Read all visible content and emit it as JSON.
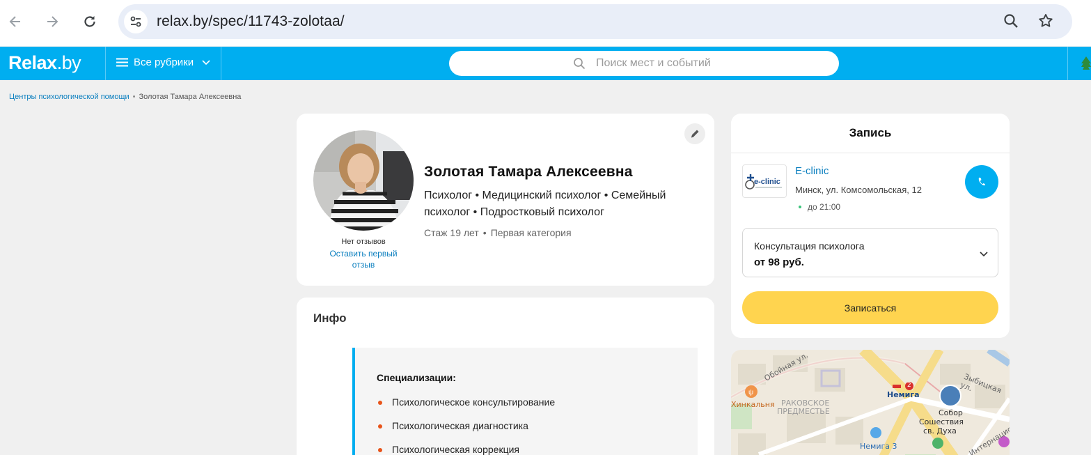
{
  "browser": {
    "url": "relax.by/spec/11743-zolotaa/"
  },
  "site": {
    "logo_main": "Relax",
    "logo_domain": ".by",
    "rubrics_label": "Все рубрики",
    "search_placeholder": "Поиск мест и событий",
    "brand_color": "#00aef0"
  },
  "breadcrumb": {
    "parent": "Центры психологической помощи",
    "separator": "•",
    "current": "Золотая Тамара Алексеевна"
  },
  "profile": {
    "name": "Золотая Тамара Алексеевна",
    "specializations": "Психолог • Медицинский психолог • Семейный психолог • Подростковый психолог",
    "experience": "Стаж 19 лет",
    "meta_separator": "•",
    "category": "Первая категория",
    "reviews_status": "Нет отзывов",
    "first_review_link": "Оставить первый отзыв"
  },
  "info": {
    "title": "Инфо",
    "spec_heading": "Специализации:",
    "spec_items": [
      "Психологическое консультирование",
      "Психологическая диагностика",
      "Психологическая коррекция"
    ]
  },
  "booking": {
    "title": "Запись",
    "clinic_name": "E-clinic",
    "clinic_logo_text": "e-clinic",
    "clinic_address": "Минск, ул. Комсомольская, 12",
    "clinic_hours": "до 21:00",
    "service_name": "Консультация психолога",
    "service_price": "от 98 руб.",
    "book_button": "Записаться",
    "button_color": "#ffd44f"
  },
  "map": {
    "labels": {
      "street1": "Обойная ул.",
      "district": "РАКОВСКОЕ ПРЕДМЕСТЬЕ",
      "district_line1": "РАКОВСКОЕ",
      "district_line2": "ПРЕДМЕСТЬЕ",
      "restaurant": "Хинкальня",
      "metro": "Немига",
      "metro_line": "2",
      "cathedral_line1": "Собор",
      "cathedral_line2": "Сошествия",
      "cathedral_line3": "св. Духа",
      "street2": "Зыбицкая ул.",
      "street3": "Интернациональная",
      "shop": "Немига 3"
    }
  }
}
